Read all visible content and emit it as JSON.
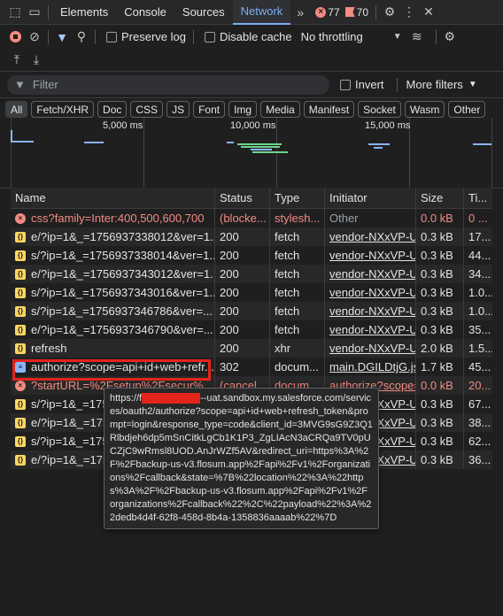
{
  "tabs": [
    "Elements",
    "Console",
    "Sources",
    "Network"
  ],
  "errors_count": "77",
  "warnings_count": "70",
  "toolbar": {
    "preserve_log": "Preserve log",
    "disable_cache": "Disable cache",
    "throttling": "No throttling"
  },
  "filter": {
    "placeholder": "Filter",
    "invert": "Invert",
    "more_filters": "More filters"
  },
  "types": [
    "All",
    "Fetch/XHR",
    "Doc",
    "CSS",
    "JS",
    "Font",
    "Img",
    "Media",
    "Manifest",
    "Socket",
    "Wasm",
    "Other"
  ],
  "overview": {
    "t1": "5,000 ms",
    "t2": "10,000 ms",
    "t3": "15,000 ms"
  },
  "columns": [
    "Name",
    "Status",
    "Type",
    "Initiator",
    "Size",
    "Ti..."
  ],
  "rows": [
    {
      "name": "css?family=Inter:400,500,600,700",
      "status": "(blocke...",
      "type": "stylesh...",
      "initiator": "Other",
      "size": "0.0 kB",
      "time": "0 ..."
    },
    {
      "name": "e/?ip=1&_=1756937338012&ver=1...",
      "status": "200",
      "type": "fetch",
      "initiator": "vendor-NXxVP-U",
      "size": "0.3 kB",
      "time": "17..."
    },
    {
      "name": "s/?ip=1&_=1756937338014&ver=1...",
      "status": "200",
      "type": "fetch",
      "initiator": "vendor-NXxVP-U",
      "size": "0.3 kB",
      "time": "44..."
    },
    {
      "name": "e/?ip=1&_=1756937343012&ver=1...",
      "status": "200",
      "type": "fetch",
      "initiator": "vendor-NXxVP-U",
      "size": "0.3 kB",
      "time": "34..."
    },
    {
      "name": "s/?ip=1&_=1756937343016&ver=1...",
      "status": "200",
      "type": "fetch",
      "initiator": "vendor-NXxVP-U",
      "size": "0.3 kB",
      "time": "1.0..."
    },
    {
      "name": "s/?ip=1&_=1756937346786&ver=...",
      "status": "200",
      "type": "fetch",
      "initiator": "vendor-NXxVP-U",
      "size": "0.3 kB",
      "time": "1.0..."
    },
    {
      "name": "e/?ip=1&_=1756937346790&ver=...",
      "status": "200",
      "type": "fetch",
      "initiator": "vendor-NXxVP-U",
      "size": "0.3 kB",
      "time": "35..."
    },
    {
      "name": "refresh",
      "status": "200",
      "type": "xhr",
      "initiator": "vendor-NXxVP-U",
      "size": "2.0 kB",
      "time": "1.5..."
    },
    {
      "name": "authorize?scope=api+id+web+refr...",
      "status": "302",
      "type": "docum...",
      "initiator": "main.DGILDtjG.js:",
      "size": "1.7 kB",
      "time": "45..."
    },
    {
      "name": "?startURL=%2Fsetup%2Fsecur%",
      "status": "(cancel...",
      "type": "docum...",
      "initiator": "authorize?scope=",
      "size": "0.0 kB",
      "time": "20..."
    },
    {
      "name": "s/?ip=1&_=1756",
      "status": "",
      "type": "",
      "initiator": "vendor-NXxVP-U",
      "size": "0.3 kB",
      "time": "67..."
    },
    {
      "name": "e/?ip=1&_=1756",
      "status": "",
      "type": "",
      "initiator": "vendor-NXxVP-U",
      "size": "0.3 kB",
      "time": "38..."
    },
    {
      "name": "s/?ip=1&_=1756",
      "status": "",
      "type": "",
      "initiator": "vendor-NXxVP-U",
      "size": "0.3 kB",
      "time": "62..."
    },
    {
      "name": "e/?ip=1&_=1756",
      "status": "",
      "type": "",
      "initiator": "vendor-NXxVP-U",
      "size": "0.3 kB",
      "time": "36..."
    }
  ],
  "tooltip": {
    "prefix": "https://f",
    "rest": "--uat.sandbox.my.salesforce.com/services/oauth2/authorize?scope=api+id+web+refresh_token&prompt=login&response_type=code&client_id=3MVG9sG9Z3Q1Rlbdjeh6dp5mSnCitkLgCb1K1P3_ZgLIAcN3aCRQa9TV0pUCZjC9wRmsl8UOD.AnJrWZf5AV&redirect_uri=https%3A%2F%2Fbackup-us-v3.flosum.app%2Fapi%2Fv1%2Forganizations%2Fcallback&state=%7B%22location%22%3A%22https%3A%2F%2Fbackup-us-v3.flosum.app%2Fapi%2Fv1%2Forganizations%2Fcallback%22%2C%22payload%22%3A%22dedb4d4f-62f8-458d-8b4a-1358836aaaab%22%7D"
  }
}
